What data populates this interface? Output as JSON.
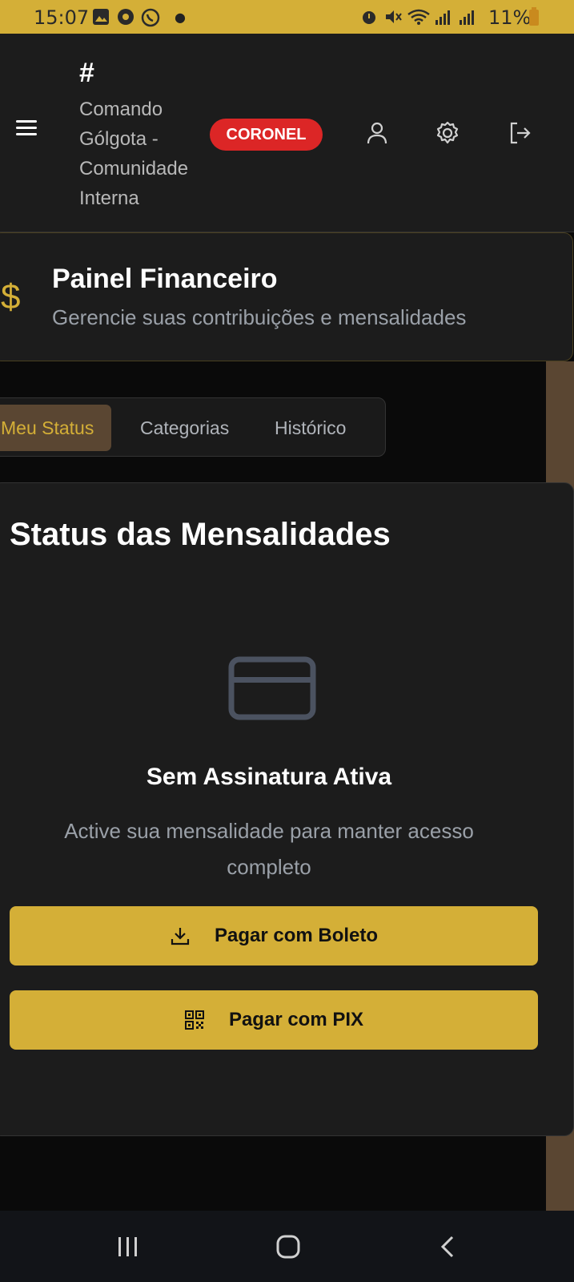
{
  "status_bar": {
    "time": "15:07",
    "battery": "11%"
  },
  "header": {
    "hash": "#",
    "app_title": "Comando Gólgota - Comunidade Interna",
    "rank_badge": "CORONEL"
  },
  "finance": {
    "icon": "$",
    "title": "Painel Financeiro",
    "subtitle": "Gerencie suas contribuições e mensalidades"
  },
  "tabs": [
    {
      "label": "Meu Status",
      "active": true
    },
    {
      "label": "Categorias",
      "active": false
    },
    {
      "label": "Histórico",
      "active": false
    }
  ],
  "status": {
    "title": "Status das Mensalidades",
    "empty_title": "Sem Assinatura Ativa",
    "empty_subtitle": "Active sua mensalidade para manter acesso completo",
    "boleto_button": "Pagar com Boleto",
    "pix_button": "Pagar com PIX"
  },
  "colors": {
    "accent": "#d4af37",
    "danger": "#dc2626",
    "card_bg": "#1c1c1c",
    "page_bg": "#0a0a0a"
  }
}
